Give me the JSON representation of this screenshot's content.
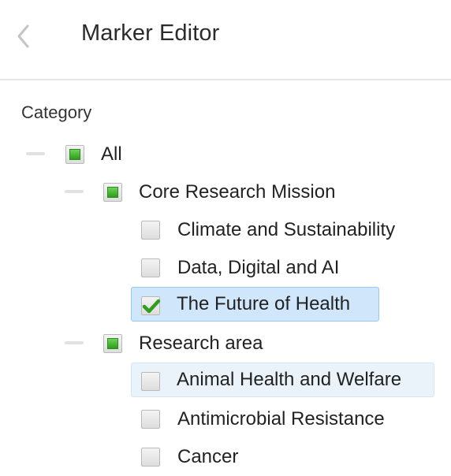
{
  "header": {
    "title": "Marker Editor",
    "back_icon": "chevron-left-icon"
  },
  "category": {
    "label": "Category",
    "tree": {
      "all": {
        "label": "All",
        "state": "partial"
      },
      "core_mission": {
        "label": "Core Research Mission",
        "state": "partial",
        "children": [
          {
            "label": "Climate and Sustainability",
            "state": "unchecked"
          },
          {
            "label": "Data, Digital and AI",
            "state": "unchecked"
          },
          {
            "label": "The Future of Health",
            "state": "checked",
            "selected": true
          }
        ]
      },
      "research_area": {
        "label": "Research area",
        "state": "partial",
        "children": [
          {
            "label": "Animal Health and Welfare",
            "state": "unchecked",
            "hovered": true
          },
          {
            "label": "Antimicrobial Resistance",
            "state": "unchecked"
          },
          {
            "label": "Cancer",
            "state": "unchecked"
          }
        ]
      }
    }
  },
  "colors": {
    "check_green": "#2f9d1e",
    "selection_blue": "#cfe6fb",
    "hover_blue": "#e9f3f9"
  }
}
